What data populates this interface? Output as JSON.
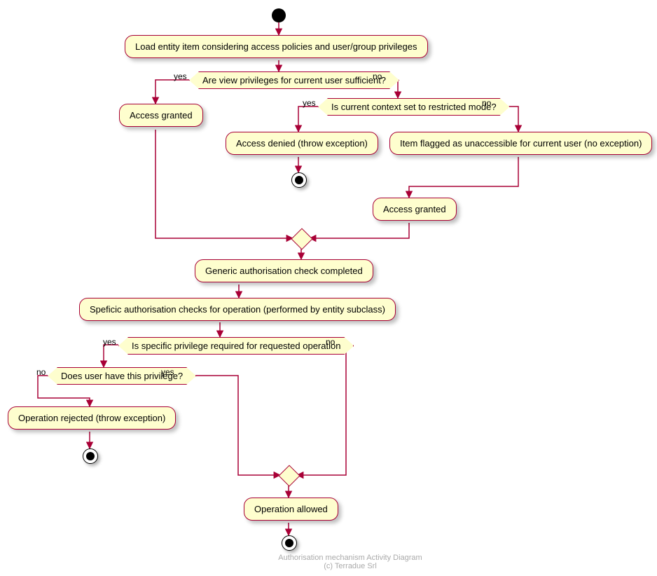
{
  "nodes": {
    "a1": "Load entity item considering access policies and user/group privileges",
    "d1": "Are view privileges for current user sufficient?",
    "a2": "Access granted",
    "d2": "Is current context set to restricted mode?",
    "a3": "Access denied (throw exception)",
    "a4": "Item flagged as unaccessible for current user (no exception)",
    "a5": "Access granted",
    "a6": "Generic authorisation check completed",
    "a7": "Speficic authorisation checks for operation (performed by entity subclass)",
    "d3": "Is specific privilege required for requested operation",
    "d4": "Does user have this privilege?",
    "a8": "Operation rejected (throw exception)",
    "a9": "Operation allowed"
  },
  "labels": {
    "yes": "yes",
    "no": "no"
  },
  "footer": {
    "line1": "Authorisation mechanism Activity Diagram",
    "line2": "(c) Terradue Srl"
  }
}
